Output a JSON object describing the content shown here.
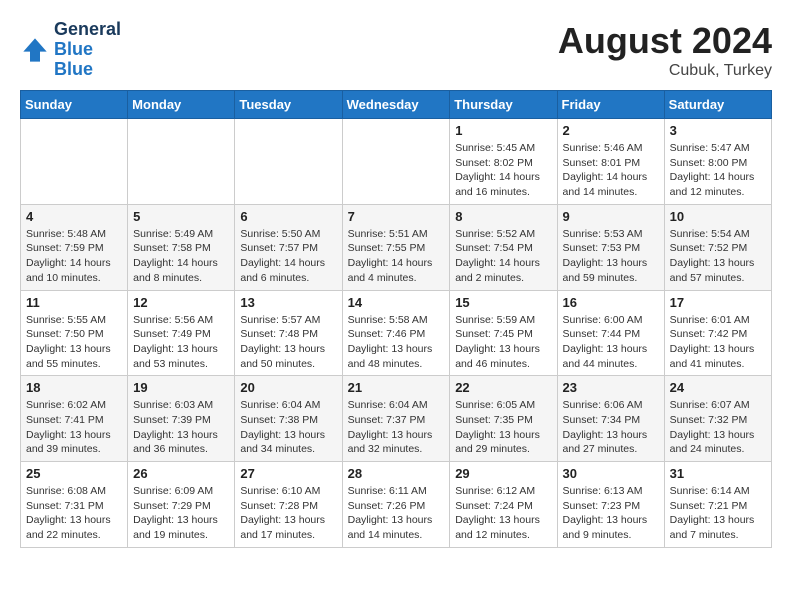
{
  "header": {
    "logo_general": "General",
    "logo_blue": "Blue",
    "month_title": "August 2024",
    "subtitle": "Cubuk, Turkey"
  },
  "days_of_week": [
    "Sunday",
    "Monday",
    "Tuesday",
    "Wednesday",
    "Thursday",
    "Friday",
    "Saturday"
  ],
  "weeks": [
    [
      {
        "day": "",
        "info": ""
      },
      {
        "day": "",
        "info": ""
      },
      {
        "day": "",
        "info": ""
      },
      {
        "day": "",
        "info": ""
      },
      {
        "day": "1",
        "info": "Sunrise: 5:45 AM\nSunset: 8:02 PM\nDaylight: 14 hours\nand 16 minutes."
      },
      {
        "day": "2",
        "info": "Sunrise: 5:46 AM\nSunset: 8:01 PM\nDaylight: 14 hours\nand 14 minutes."
      },
      {
        "day": "3",
        "info": "Sunrise: 5:47 AM\nSunset: 8:00 PM\nDaylight: 14 hours\nand 12 minutes."
      }
    ],
    [
      {
        "day": "4",
        "info": "Sunrise: 5:48 AM\nSunset: 7:59 PM\nDaylight: 14 hours\nand 10 minutes."
      },
      {
        "day": "5",
        "info": "Sunrise: 5:49 AM\nSunset: 7:58 PM\nDaylight: 14 hours\nand 8 minutes."
      },
      {
        "day": "6",
        "info": "Sunrise: 5:50 AM\nSunset: 7:57 PM\nDaylight: 14 hours\nand 6 minutes."
      },
      {
        "day": "7",
        "info": "Sunrise: 5:51 AM\nSunset: 7:55 PM\nDaylight: 14 hours\nand 4 minutes."
      },
      {
        "day": "8",
        "info": "Sunrise: 5:52 AM\nSunset: 7:54 PM\nDaylight: 14 hours\nand 2 minutes."
      },
      {
        "day": "9",
        "info": "Sunrise: 5:53 AM\nSunset: 7:53 PM\nDaylight: 13 hours\nand 59 minutes."
      },
      {
        "day": "10",
        "info": "Sunrise: 5:54 AM\nSunset: 7:52 PM\nDaylight: 13 hours\nand 57 minutes."
      }
    ],
    [
      {
        "day": "11",
        "info": "Sunrise: 5:55 AM\nSunset: 7:50 PM\nDaylight: 13 hours\nand 55 minutes."
      },
      {
        "day": "12",
        "info": "Sunrise: 5:56 AM\nSunset: 7:49 PM\nDaylight: 13 hours\nand 53 minutes."
      },
      {
        "day": "13",
        "info": "Sunrise: 5:57 AM\nSunset: 7:48 PM\nDaylight: 13 hours\nand 50 minutes."
      },
      {
        "day": "14",
        "info": "Sunrise: 5:58 AM\nSunset: 7:46 PM\nDaylight: 13 hours\nand 48 minutes."
      },
      {
        "day": "15",
        "info": "Sunrise: 5:59 AM\nSunset: 7:45 PM\nDaylight: 13 hours\nand 46 minutes."
      },
      {
        "day": "16",
        "info": "Sunrise: 6:00 AM\nSunset: 7:44 PM\nDaylight: 13 hours\nand 44 minutes."
      },
      {
        "day": "17",
        "info": "Sunrise: 6:01 AM\nSunset: 7:42 PM\nDaylight: 13 hours\nand 41 minutes."
      }
    ],
    [
      {
        "day": "18",
        "info": "Sunrise: 6:02 AM\nSunset: 7:41 PM\nDaylight: 13 hours\nand 39 minutes."
      },
      {
        "day": "19",
        "info": "Sunrise: 6:03 AM\nSunset: 7:39 PM\nDaylight: 13 hours\nand 36 minutes."
      },
      {
        "day": "20",
        "info": "Sunrise: 6:04 AM\nSunset: 7:38 PM\nDaylight: 13 hours\nand 34 minutes."
      },
      {
        "day": "21",
        "info": "Sunrise: 6:04 AM\nSunset: 7:37 PM\nDaylight: 13 hours\nand 32 minutes."
      },
      {
        "day": "22",
        "info": "Sunrise: 6:05 AM\nSunset: 7:35 PM\nDaylight: 13 hours\nand 29 minutes."
      },
      {
        "day": "23",
        "info": "Sunrise: 6:06 AM\nSunset: 7:34 PM\nDaylight: 13 hours\nand 27 minutes."
      },
      {
        "day": "24",
        "info": "Sunrise: 6:07 AM\nSunset: 7:32 PM\nDaylight: 13 hours\nand 24 minutes."
      }
    ],
    [
      {
        "day": "25",
        "info": "Sunrise: 6:08 AM\nSunset: 7:31 PM\nDaylight: 13 hours\nand 22 minutes."
      },
      {
        "day": "26",
        "info": "Sunrise: 6:09 AM\nSunset: 7:29 PM\nDaylight: 13 hours\nand 19 minutes."
      },
      {
        "day": "27",
        "info": "Sunrise: 6:10 AM\nSunset: 7:28 PM\nDaylight: 13 hours\nand 17 minutes."
      },
      {
        "day": "28",
        "info": "Sunrise: 6:11 AM\nSunset: 7:26 PM\nDaylight: 13 hours\nand 14 minutes."
      },
      {
        "day": "29",
        "info": "Sunrise: 6:12 AM\nSunset: 7:24 PM\nDaylight: 13 hours\nand 12 minutes."
      },
      {
        "day": "30",
        "info": "Sunrise: 6:13 AM\nSunset: 7:23 PM\nDaylight: 13 hours\nand 9 minutes."
      },
      {
        "day": "31",
        "info": "Sunrise: 6:14 AM\nSunset: 7:21 PM\nDaylight: 13 hours\nand 7 minutes."
      }
    ]
  ]
}
